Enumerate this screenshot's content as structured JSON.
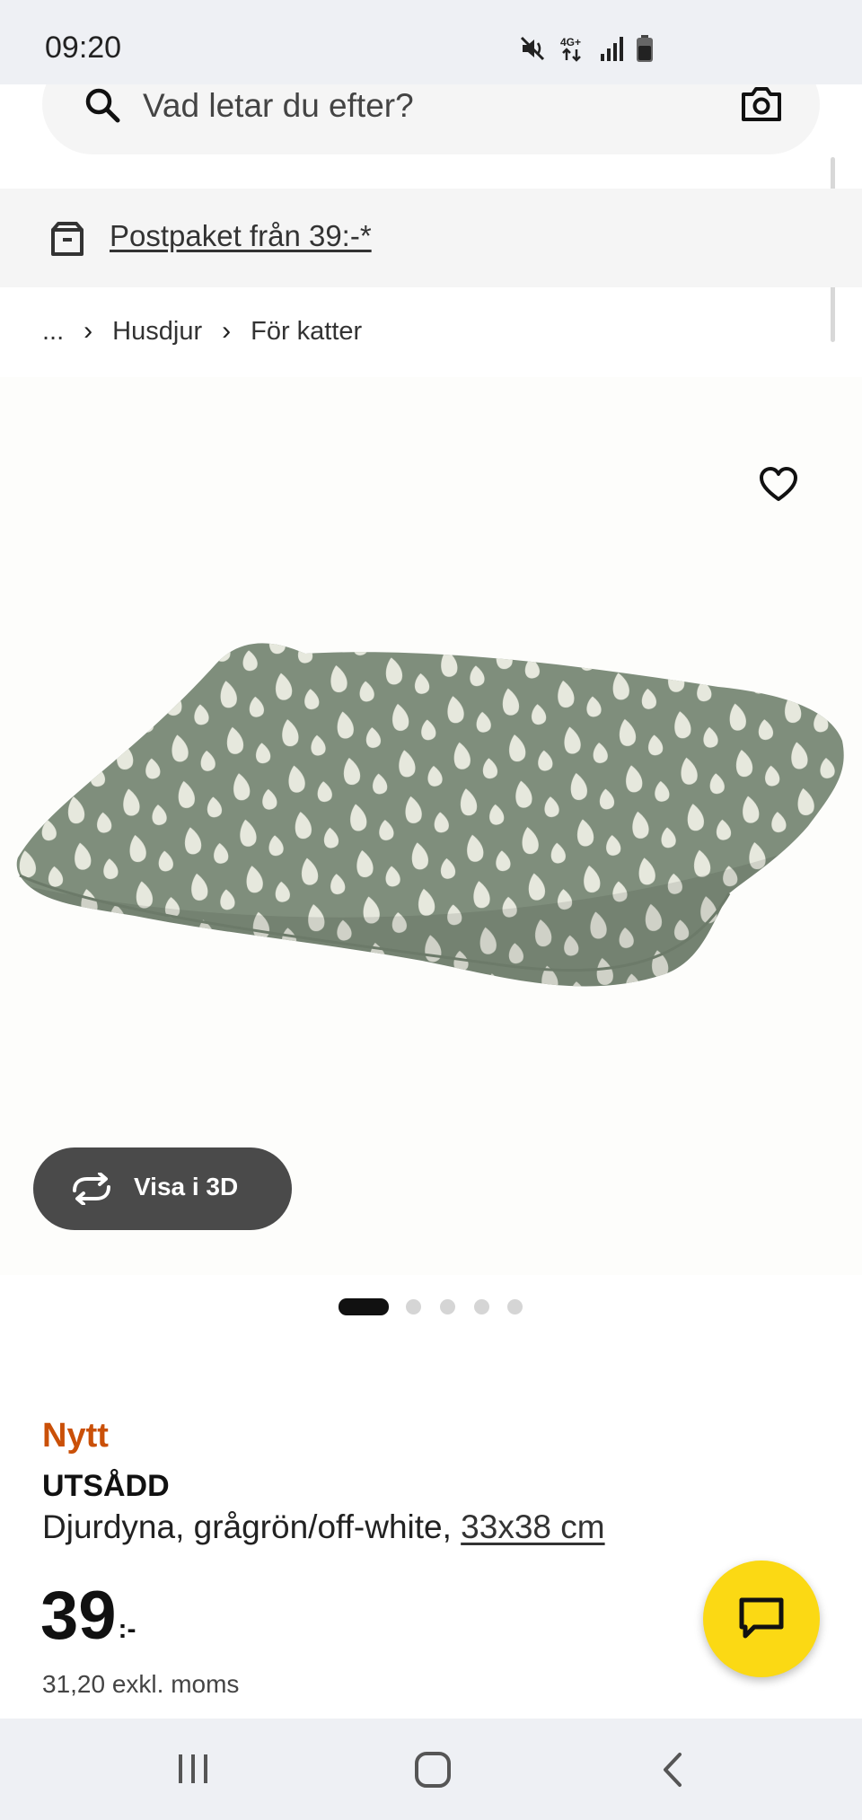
{
  "status_bar": {
    "time": "09:20",
    "icons": [
      "mute-icon",
      "4g-icon",
      "signal-icon",
      "battery-icon"
    ],
    "network_label": "4G+"
  },
  "search": {
    "placeholder": "Vad letar du efter?",
    "icons": [
      "search-icon",
      "camera-icon"
    ]
  },
  "promo": {
    "icon": "parcel-icon",
    "link_text": "Postpaket från 39:-*"
  },
  "breadcrumb": {
    "items": [
      "...",
      "Husdjur",
      "För katter"
    ]
  },
  "gallery": {
    "image_count": 5,
    "active_index": 0,
    "wishlist_icon": "heart-icon",
    "view3d_label": "Visa i 3D"
  },
  "product": {
    "badge": "Nytt",
    "name": "UTSÅDD",
    "description": "Djurdyna, grågrön/off-white,",
    "size": "33x38 cm",
    "price_integer": "39",
    "price_suffix": ":-",
    "price_excl": "31,20 exkl. moms"
  },
  "chat": {
    "icon": "chat-icon"
  },
  "colors": {
    "badge_color": "#ca5008",
    "chat_button": "#fbd914",
    "cushion_green": "#7f8e7c",
    "cushion_dots": "#e6e8dd"
  }
}
